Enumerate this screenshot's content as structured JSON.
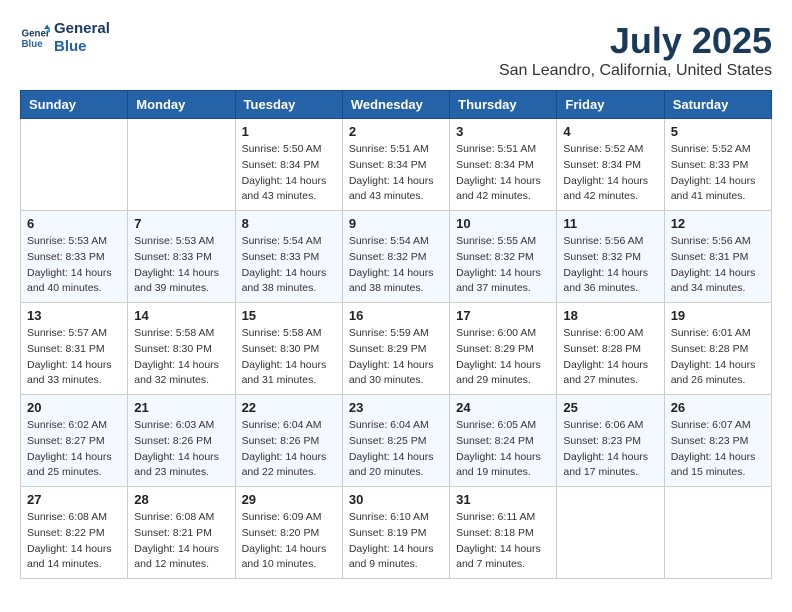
{
  "header": {
    "logo_line1": "General",
    "logo_line2": "Blue",
    "title": "July 2025",
    "subtitle": "San Leandro, California, United States"
  },
  "days_of_week": [
    "Sunday",
    "Monday",
    "Tuesday",
    "Wednesday",
    "Thursday",
    "Friday",
    "Saturday"
  ],
  "weeks": [
    [
      {
        "day": "",
        "info": ""
      },
      {
        "day": "",
        "info": ""
      },
      {
        "day": "1",
        "info": "Sunrise: 5:50 AM\nSunset: 8:34 PM\nDaylight: 14 hours and 43 minutes."
      },
      {
        "day": "2",
        "info": "Sunrise: 5:51 AM\nSunset: 8:34 PM\nDaylight: 14 hours and 43 minutes."
      },
      {
        "day": "3",
        "info": "Sunrise: 5:51 AM\nSunset: 8:34 PM\nDaylight: 14 hours and 42 minutes."
      },
      {
        "day": "4",
        "info": "Sunrise: 5:52 AM\nSunset: 8:34 PM\nDaylight: 14 hours and 42 minutes."
      },
      {
        "day": "5",
        "info": "Sunrise: 5:52 AM\nSunset: 8:33 PM\nDaylight: 14 hours and 41 minutes."
      }
    ],
    [
      {
        "day": "6",
        "info": "Sunrise: 5:53 AM\nSunset: 8:33 PM\nDaylight: 14 hours and 40 minutes."
      },
      {
        "day": "7",
        "info": "Sunrise: 5:53 AM\nSunset: 8:33 PM\nDaylight: 14 hours and 39 minutes."
      },
      {
        "day": "8",
        "info": "Sunrise: 5:54 AM\nSunset: 8:33 PM\nDaylight: 14 hours and 38 minutes."
      },
      {
        "day": "9",
        "info": "Sunrise: 5:54 AM\nSunset: 8:32 PM\nDaylight: 14 hours and 38 minutes."
      },
      {
        "day": "10",
        "info": "Sunrise: 5:55 AM\nSunset: 8:32 PM\nDaylight: 14 hours and 37 minutes."
      },
      {
        "day": "11",
        "info": "Sunrise: 5:56 AM\nSunset: 8:32 PM\nDaylight: 14 hours and 36 minutes."
      },
      {
        "day": "12",
        "info": "Sunrise: 5:56 AM\nSunset: 8:31 PM\nDaylight: 14 hours and 34 minutes."
      }
    ],
    [
      {
        "day": "13",
        "info": "Sunrise: 5:57 AM\nSunset: 8:31 PM\nDaylight: 14 hours and 33 minutes."
      },
      {
        "day": "14",
        "info": "Sunrise: 5:58 AM\nSunset: 8:30 PM\nDaylight: 14 hours and 32 minutes."
      },
      {
        "day": "15",
        "info": "Sunrise: 5:58 AM\nSunset: 8:30 PM\nDaylight: 14 hours and 31 minutes."
      },
      {
        "day": "16",
        "info": "Sunrise: 5:59 AM\nSunset: 8:29 PM\nDaylight: 14 hours and 30 minutes."
      },
      {
        "day": "17",
        "info": "Sunrise: 6:00 AM\nSunset: 8:29 PM\nDaylight: 14 hours and 29 minutes."
      },
      {
        "day": "18",
        "info": "Sunrise: 6:00 AM\nSunset: 8:28 PM\nDaylight: 14 hours and 27 minutes."
      },
      {
        "day": "19",
        "info": "Sunrise: 6:01 AM\nSunset: 8:28 PM\nDaylight: 14 hours and 26 minutes."
      }
    ],
    [
      {
        "day": "20",
        "info": "Sunrise: 6:02 AM\nSunset: 8:27 PM\nDaylight: 14 hours and 25 minutes."
      },
      {
        "day": "21",
        "info": "Sunrise: 6:03 AM\nSunset: 8:26 PM\nDaylight: 14 hours and 23 minutes."
      },
      {
        "day": "22",
        "info": "Sunrise: 6:04 AM\nSunset: 8:26 PM\nDaylight: 14 hours and 22 minutes."
      },
      {
        "day": "23",
        "info": "Sunrise: 6:04 AM\nSunset: 8:25 PM\nDaylight: 14 hours and 20 minutes."
      },
      {
        "day": "24",
        "info": "Sunrise: 6:05 AM\nSunset: 8:24 PM\nDaylight: 14 hours and 19 minutes."
      },
      {
        "day": "25",
        "info": "Sunrise: 6:06 AM\nSunset: 8:23 PM\nDaylight: 14 hours and 17 minutes."
      },
      {
        "day": "26",
        "info": "Sunrise: 6:07 AM\nSunset: 8:23 PM\nDaylight: 14 hours and 15 minutes."
      }
    ],
    [
      {
        "day": "27",
        "info": "Sunrise: 6:08 AM\nSunset: 8:22 PM\nDaylight: 14 hours and 14 minutes."
      },
      {
        "day": "28",
        "info": "Sunrise: 6:08 AM\nSunset: 8:21 PM\nDaylight: 14 hours and 12 minutes."
      },
      {
        "day": "29",
        "info": "Sunrise: 6:09 AM\nSunset: 8:20 PM\nDaylight: 14 hours and 10 minutes."
      },
      {
        "day": "30",
        "info": "Sunrise: 6:10 AM\nSunset: 8:19 PM\nDaylight: 14 hours and 9 minutes."
      },
      {
        "day": "31",
        "info": "Sunrise: 6:11 AM\nSunset: 8:18 PM\nDaylight: 14 hours and 7 minutes."
      },
      {
        "day": "",
        "info": ""
      },
      {
        "day": "",
        "info": ""
      }
    ]
  ]
}
